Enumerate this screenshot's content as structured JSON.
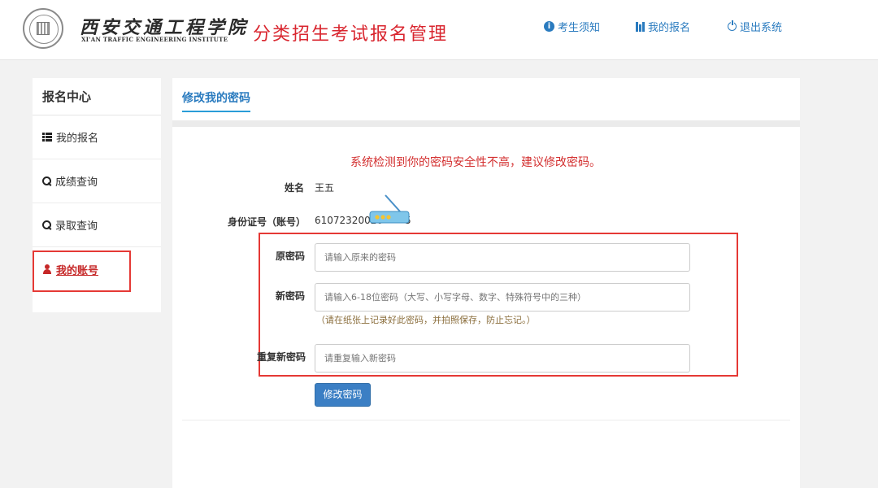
{
  "header": {
    "school_cn": "西安交通工程学院",
    "school_en": "XI'AN TRAFFIC ENGINEERING INSTITUTE",
    "system_title": "分类招生考试报名管理",
    "nav": [
      {
        "label": "考生须知",
        "icon": "info-icon"
      },
      {
        "label": "我的报名",
        "icon": "bar-chart-icon"
      },
      {
        "label": "退出系统",
        "icon": "power-icon"
      }
    ]
  },
  "sidebar": {
    "title": "报名中心",
    "items": [
      {
        "label": "我的报名",
        "icon": "list-icon"
      },
      {
        "label": "成绩查询",
        "icon": "search-icon"
      },
      {
        "label": "录取查询",
        "icon": "search-icon"
      },
      {
        "label": "我的账号",
        "icon": "user-icon",
        "active": true
      }
    ]
  },
  "main": {
    "tab_title": "修改我的密码",
    "warning": "系统检测到你的密码安全性不高，建议修改密码。",
    "name_label": "姓名",
    "name_value": "王五",
    "id_label": "身份证号（账号）",
    "id_value_visible": "61072320020",
    "id_value_tail": "5",
    "old_password": {
      "label": "原密码",
      "placeholder": "请输入原来的密码",
      "value": ""
    },
    "new_password": {
      "label": "新密码",
      "placeholder": "请输入6-18位密码（大写、小写字母、数字、特殊符号中的三种）",
      "value": ""
    },
    "hint": "（请在纸张上记录好此密码，并拍照保存，防止忘记。）",
    "confirm_password": {
      "label": "重复新密码",
      "placeholder": "请重复输入新密码",
      "value": ""
    },
    "submit_label": "修改密码"
  },
  "colors": {
    "accent": "#2a7bbf",
    "warning": "#d32f2f",
    "highlight_box": "#e53935",
    "button": "#3b7fc4"
  }
}
